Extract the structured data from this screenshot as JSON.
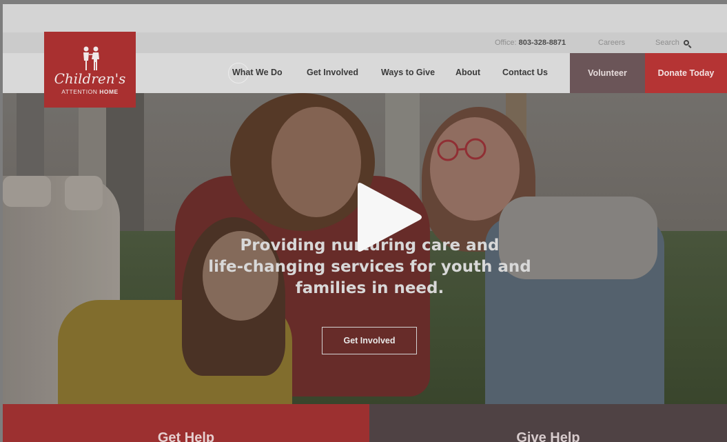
{
  "utility": {
    "phone_label": "Office: ",
    "phone_number": "803-328-8871",
    "careers": "Careers",
    "search": "Search"
  },
  "logo": {
    "script": "Children's",
    "sub_light": "ATTENTION ",
    "sub_bold": "HOME"
  },
  "nav": {
    "what_we_do": "What We Do",
    "get_involved": "Get Involved",
    "ways_to_give": "Ways to Give",
    "about": "About",
    "contact_us": "Contact Us",
    "volunteer": "Volunteer",
    "donate": "Donate Today"
  },
  "hero": {
    "line1": "Providing nurturing care and",
    "line2": "life-changing services for youth and",
    "line3": "families in need.",
    "button": "Get Involved"
  },
  "bottom": {
    "get_help": "Get Help",
    "give_help": "Give Help"
  },
  "colors": {
    "brand_red": "#b53434",
    "volunteer_mauve": "#6b5558",
    "give_help_dark": "#4f4244"
  }
}
